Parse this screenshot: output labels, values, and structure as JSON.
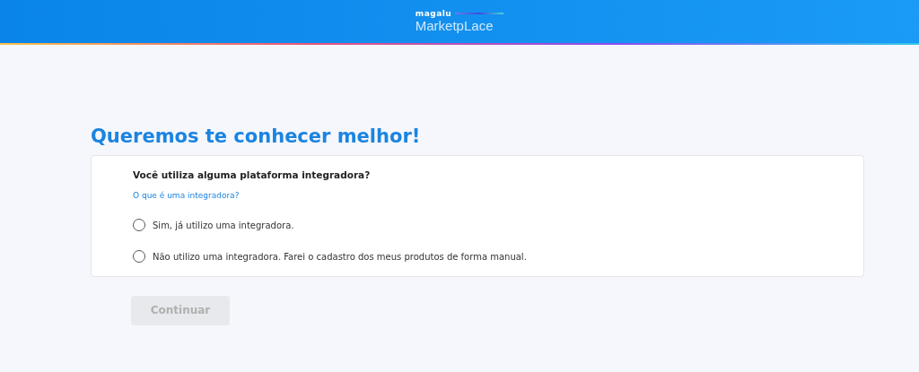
{
  "header": {
    "brand": "magalu",
    "product": "MarketpLace"
  },
  "title": "Queremos te conhecer melhor!",
  "question": {
    "label": "Você utiliza alguma plataforma integradora?",
    "help_link": "O que é uma integradora?"
  },
  "options": [
    {
      "label": "Sim, já utilizo uma integradora.",
      "selected": false
    },
    {
      "label": "Não utilizo uma integradora. Farei o cadastro dos meus produtos de forma manual.",
      "selected": false
    }
  ],
  "continue_button": {
    "label": "Continuar",
    "disabled": true
  }
}
